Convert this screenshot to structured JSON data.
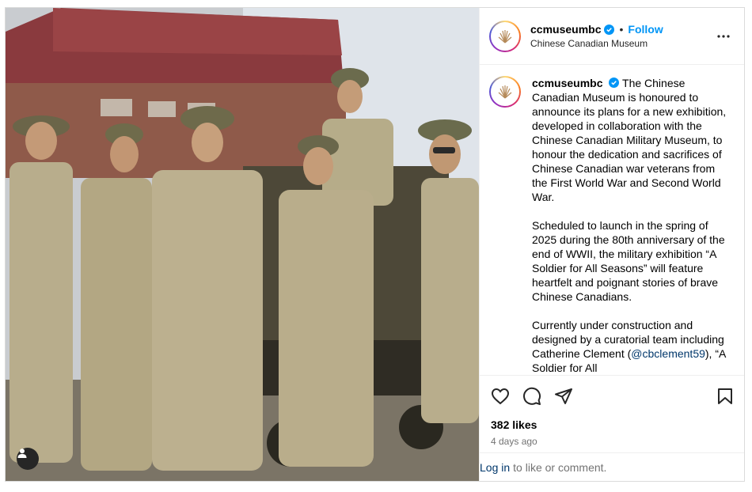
{
  "post": {
    "username": "ccmuseumbc",
    "follow_label": "Follow",
    "separator": "•",
    "display_name": "Chinese Canadian Museum",
    "caption": {
      "username": "ccmuseumbc",
      "paragraphs": [
        "The Chinese Canadian Museum is honoured to announce its plans for a new exhibition, developed in collaboration with the Chinese Canadian Military Museum, to honour the dedication and sacrifices of Chinese Canadian war veterans from the First World War and Second World War.",
        "Scheduled to launch in the spring of 2025 during the 80th anniversary of the end of WWII, the military exhibition “A Soldier for All Seasons” will feature heartfelt and poignant stories of brave Chinese Canadians.",
        "Currently under construction and designed by a curatorial team including Catherine Clement"
      ],
      "mention_prefix": "(",
      "mention": "@cbclement59",
      "mention_suffix": "), “A Soldier for All"
    },
    "likes": "382 likes",
    "time_ago": "4 days ago",
    "login_link": "Log in",
    "login_text": "to like or comment."
  },
  "icons": {
    "verified": "verified-badge-icon",
    "more": "more-options-icon",
    "like": "heart-icon",
    "comment": "comment-icon",
    "share": "share-icon",
    "save": "bookmark-icon",
    "tag": "user-tag-icon"
  },
  "colors": {
    "accent": "#0095f6",
    "link": "#00376b",
    "muted": "#737373"
  }
}
